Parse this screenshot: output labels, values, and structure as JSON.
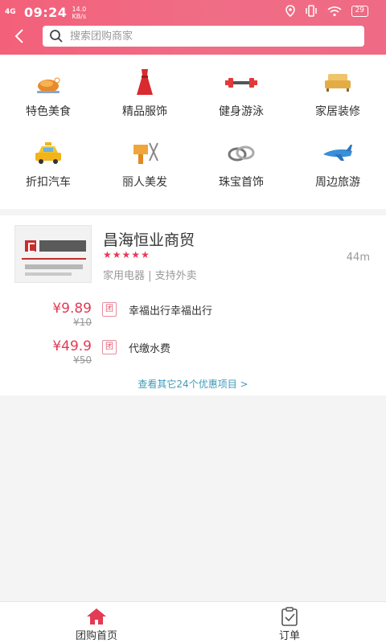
{
  "status_bar": {
    "network": "4G",
    "time": "09:24",
    "speed_value": "14.0",
    "speed_unit": "KB/s",
    "battery": "29"
  },
  "search": {
    "placeholder": "搜索团购商家"
  },
  "categories": [
    {
      "label": "特色美食",
      "icon": "roast-chicken-icon"
    },
    {
      "label": "精品服饰",
      "icon": "red-dress-icon"
    },
    {
      "label": "健身游泳",
      "icon": "dumbbell-icon"
    },
    {
      "label": "家居装修",
      "icon": "sofa-icon"
    },
    {
      "label": "折扣汽车",
      "icon": "taxi-icon"
    },
    {
      "label": "丽人美发",
      "icon": "hair-dryer-icon"
    },
    {
      "label": "珠宝首饰",
      "icon": "rings-icon"
    },
    {
      "label": "周边旅游",
      "icon": "airplane-icon"
    }
  ],
  "shop": {
    "name": "昌海恒业商贸",
    "rating": 5,
    "distance": "44m",
    "tags": "家用电器 | 支持外卖",
    "deals": [
      {
        "price": "¥9.89",
        "original": "¥10",
        "badge": "团",
        "name": "幸福出行幸福出行"
      },
      {
        "price": "¥49.9",
        "original": "¥50",
        "badge": "团",
        "name": "代缴水费"
      }
    ],
    "more_link": "查看其它24个优惠项目 >"
  },
  "bottom_nav": [
    {
      "label": "团购首页",
      "icon": "home-icon"
    },
    {
      "label": "订单",
      "icon": "order-clipboard-icon"
    }
  ],
  "colors": {
    "header": "#f0647e",
    "accent": "#e33a55",
    "link": "#3e9bb9"
  }
}
